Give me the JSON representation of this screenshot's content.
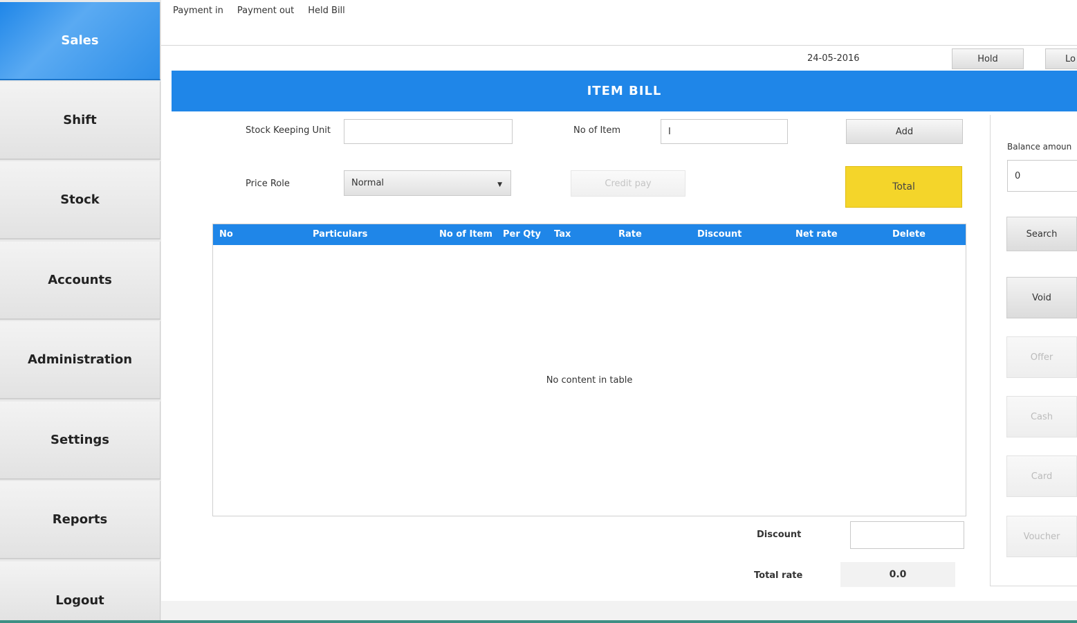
{
  "sidebar": {
    "items": [
      {
        "label": "Sales",
        "active": true
      },
      {
        "label": "Shift"
      },
      {
        "label": "Stock"
      },
      {
        "label": "Accounts"
      },
      {
        "label": "Administration"
      },
      {
        "label": "Settings"
      },
      {
        "label": "Reports"
      },
      {
        "label": "Logout"
      }
    ]
  },
  "topmenu": {
    "payment_in": "Payment in",
    "payment_out": "Payment out",
    "held_bill": "Held Bill"
  },
  "header": {
    "date": "24-05-2016",
    "hold_label": "Hold",
    "lo_label": "Lo"
  },
  "banner": {
    "title": "ITEM  BILL"
  },
  "form": {
    "sku_label": "Stock Keeping Unit",
    "sku_value": "",
    "no_of_item_label": "No of Item",
    "no_of_item_value": "I",
    "add_label": "Add",
    "price_role_label": "Price Role",
    "price_role_value": "Normal",
    "credit_pay_label": "Credit pay",
    "total_label": "Total"
  },
  "table": {
    "columns": [
      "No",
      "Particulars",
      "No of Item",
      "Per Qty",
      "Tax",
      "Rate",
      "Discount",
      "Net rate",
      "Delete"
    ],
    "empty_text": "No content in table"
  },
  "summary": {
    "discount_label": "Discount",
    "discount_value": "",
    "total_rate_label": "Total rate",
    "total_rate_value": "0.0"
  },
  "right_panel": {
    "balance_label": "Balance amoun",
    "balance_value": "0",
    "search_label": "Search",
    "void_label": "Void",
    "offer_label": "Offer",
    "cash_label": "Cash",
    "card_label": "Card",
    "voucher_label": "Voucher"
  },
  "colors": {
    "accent": "#1f86e8",
    "total_button": "#f4d52a"
  }
}
